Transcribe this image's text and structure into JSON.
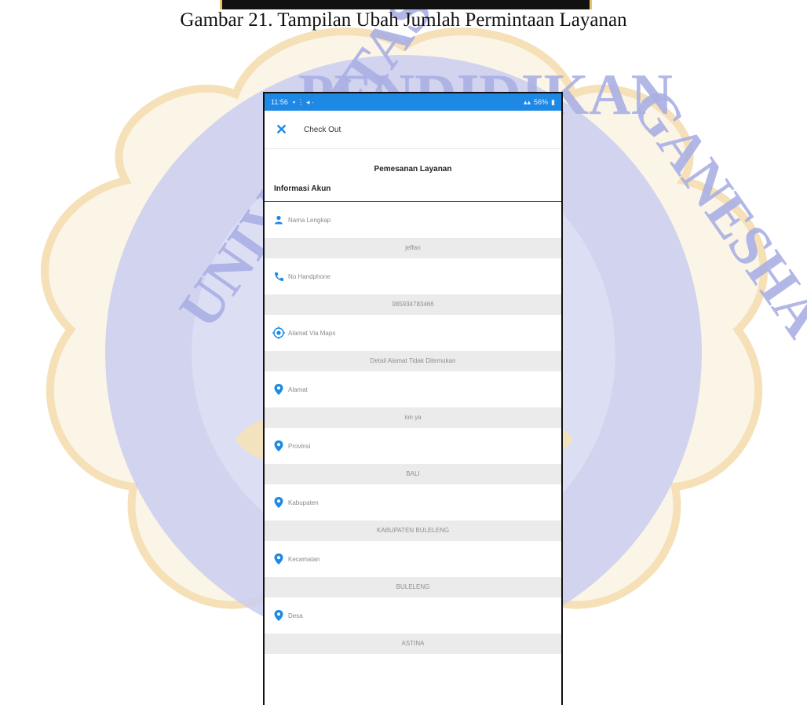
{
  "caption": "Gambar 21. Tampilan Ubah Jumlah Permintaan Layanan",
  "watermark": {
    "text_left": "UNIVERSITAS",
    "text_top": "PENDIDIKAN",
    "text_right": "GANESHA",
    "colors": {
      "circle": "#c9cdf0",
      "frame": "#f3d9a6"
    }
  },
  "phone": {
    "status_bar": {
      "time": "11:56",
      "right": "56%"
    },
    "app_bar": {
      "close_icon": "close-icon",
      "title": "Check Out"
    },
    "heading": "Pemesanan Layanan",
    "subheading": "Informasi Akun",
    "fields": [
      {
        "icon": "person-icon",
        "label": "Nama Lengkap",
        "value": "jeffan"
      },
      {
        "icon": "phone-icon",
        "label": "No Handphone",
        "value": "085934783466"
      },
      {
        "icon": "target-icon",
        "label": "Alamat Via Maps",
        "value": "Detail Alamat Tidak Ditemukan"
      },
      {
        "icon": "location-pin-icon",
        "label": "Alamat",
        "value": "ion ya"
      },
      {
        "icon": "location-pin-icon",
        "label": "Provinsi",
        "value": "BALI"
      },
      {
        "icon": "location-pin-icon",
        "label": "Kabupaten",
        "value": "KABUPATEN BULELENG"
      },
      {
        "icon": "location-pin-icon",
        "label": "Kecamatan",
        "value": "BULELENG"
      },
      {
        "icon": "location-pin-icon",
        "label": "Desa",
        "value": "ASTINA"
      }
    ],
    "accent_color": "#1e88e5"
  }
}
